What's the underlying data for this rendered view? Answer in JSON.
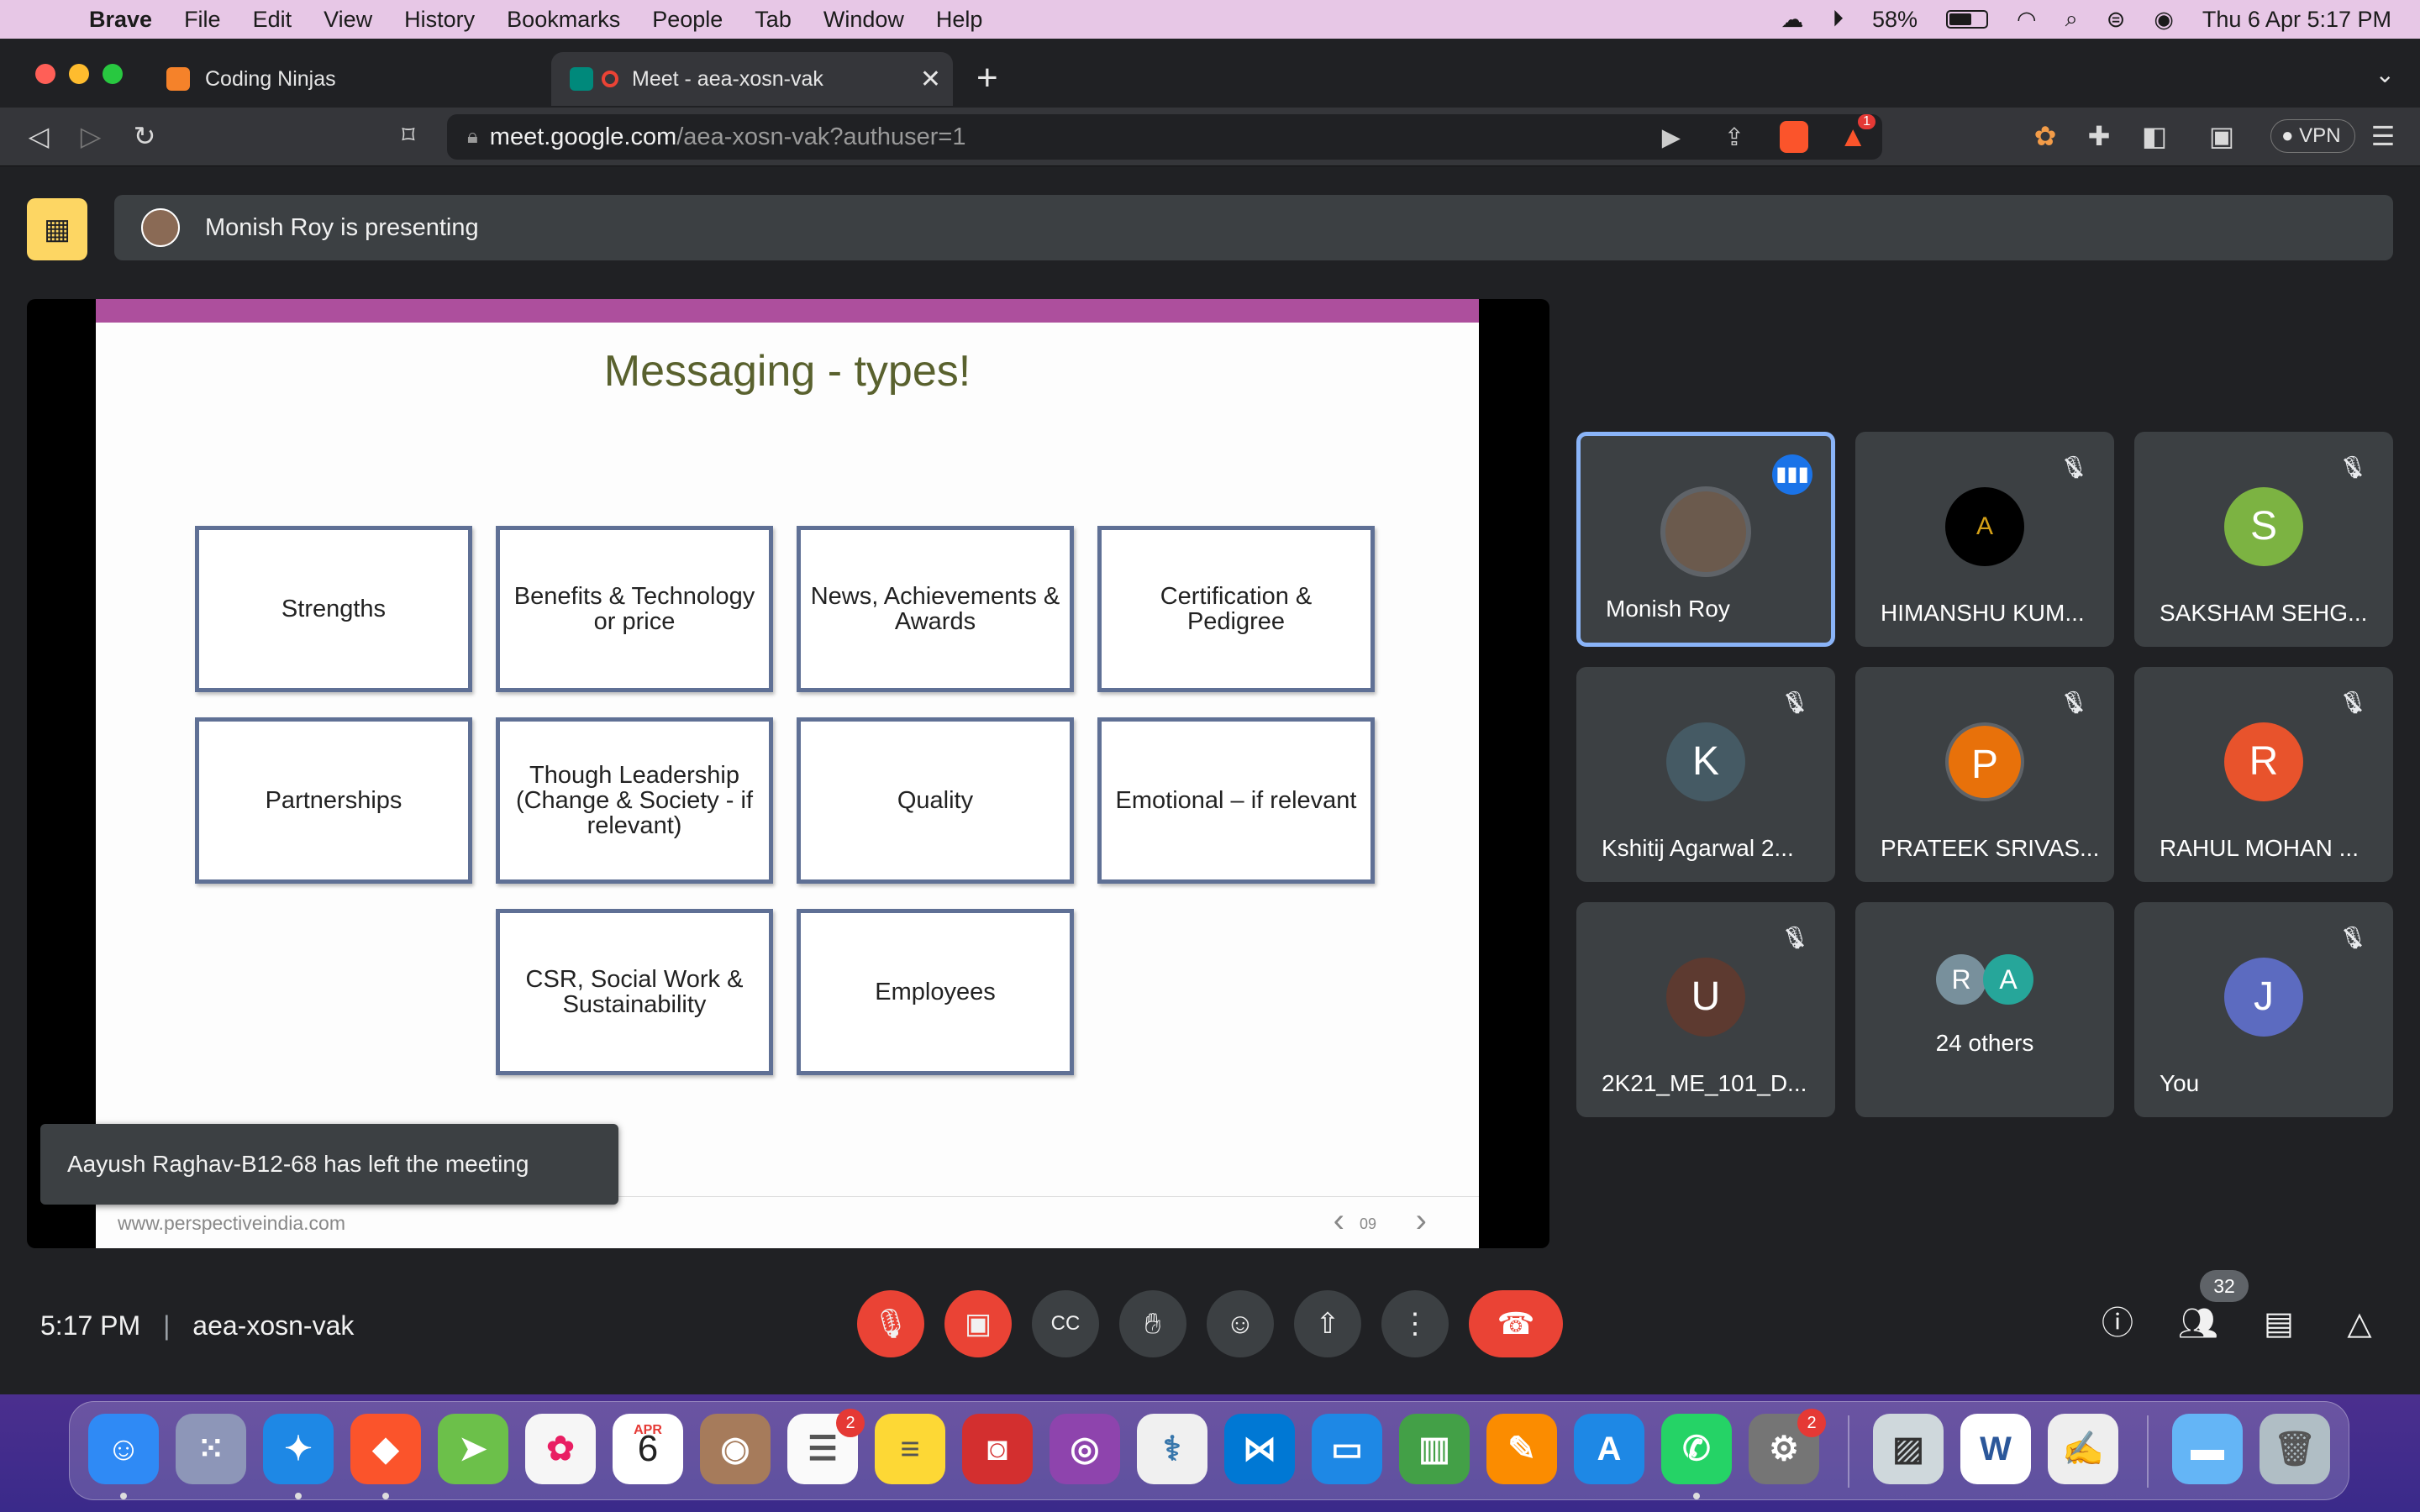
{
  "menubar": {
    "app": "Brave",
    "items": [
      "File",
      "Edit",
      "View",
      "History",
      "Bookmarks",
      "People",
      "Tab",
      "Window",
      "Help"
    ],
    "battery": "58%",
    "clock": "Thu 6 Apr  5:17 PM"
  },
  "tabs": [
    {
      "label": "Coding Ninjas"
    },
    {
      "label": "Meet - aea-xosn-vak"
    }
  ],
  "url": {
    "host": "meet.google.com",
    "path": "/aea-xosn-vak?authuser=1"
  },
  "toolbar": {
    "shield_count": "1",
    "vpn": "VPN"
  },
  "presenting": {
    "text": "Monish Roy is presenting"
  },
  "slide": {
    "title": "Messaging - types!",
    "cards": [
      "Strengths",
      "Benefits & Technology or price",
      "News, Achievements & Awards",
      "Certification & Pedigree",
      "Partnerships",
      "Though Leadership (Change & Society - if relevant)",
      "Quality",
      "Emotional – if relevant",
      "CSR, Social Work & Sustainability",
      "Employees"
    ],
    "footer": "www.perspectiveindia.com",
    "page": "09"
  },
  "toast": "Aayush Raghav-B12-68 has left the meeting",
  "participants": [
    {
      "name": "Monish Roy",
      "initial": "",
      "color": "#6b5a4d"
    },
    {
      "name": "HIMANSHU KUM...",
      "initial": "",
      "color": "#000000"
    },
    {
      "name": "SAKSHAM SEHG...",
      "initial": "S",
      "color": "#7cb342"
    },
    {
      "name": "Kshitij Agarwal 2...",
      "initial": "K",
      "color": "#455a64"
    },
    {
      "name": "PRATEEK SRIVAS...",
      "initial": "P",
      "color": "#e8710a"
    },
    {
      "name": "RAHUL MOHAN ...",
      "initial": "R",
      "color": "#e8532c"
    },
    {
      "name": "2K21_ME_101_D...",
      "initial": "U",
      "color": "#5d3a30"
    },
    {
      "name": "24 others",
      "initial": "",
      "color": ""
    },
    {
      "name": "You",
      "initial": "J",
      "color": "#5c6bc0"
    }
  ],
  "others": {
    "a": "R",
    "b": "A"
  },
  "meeting": {
    "time": "5:17 PM",
    "sep": "|",
    "code": "aea-xosn-vak"
  },
  "people_count": "32",
  "dock": {
    "calendar_month": "APR",
    "calendar_day": "6",
    "reminders_badge": "2",
    "prefs_badge": "2"
  }
}
